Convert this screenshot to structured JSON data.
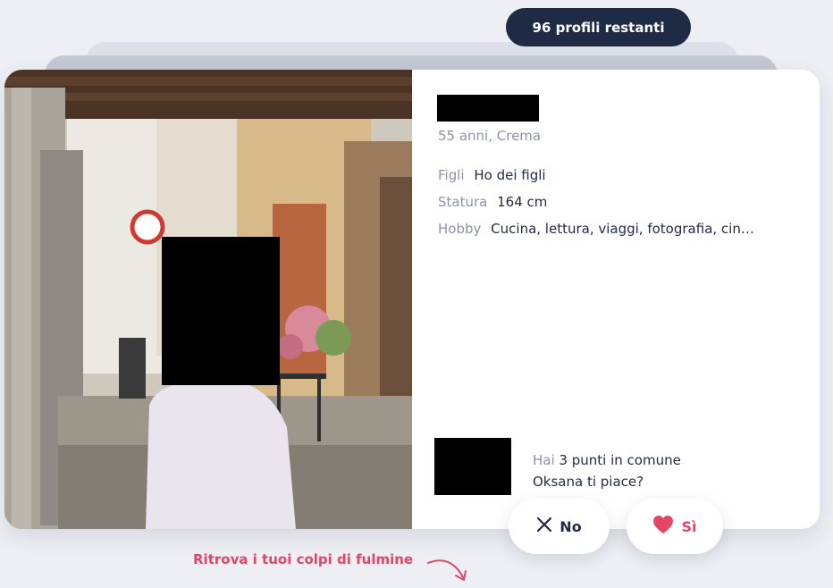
{
  "header": {
    "remaining_profiles": "96 profili restanti"
  },
  "profile": {
    "age_city": "55 anni, Crema",
    "attributes": [
      {
        "label": "Figli",
        "value": "Ho dei figli"
      },
      {
        "label": "Statura",
        "value": "164 cm"
      },
      {
        "label": "Hobby",
        "value": "Cucina, lettura, viaggi, fotografia, cin…"
      }
    ],
    "common_prefix": "Hai",
    "common_points": "3 punti in comune",
    "question": "Oksana ti piace?"
  },
  "actions": {
    "no_label": "No",
    "yes_label": "Sì"
  },
  "footer": {
    "hint": "Ritrova i tuoi colpi di fulmine"
  },
  "icons": {
    "no": "close-x-icon",
    "yes": "heart-icon",
    "hint": "curved-arrow-icon"
  },
  "colors": {
    "navy": "#1f2a44",
    "accent": "#e54565",
    "muted": "#8a93a8",
    "background": "#edeff4"
  }
}
